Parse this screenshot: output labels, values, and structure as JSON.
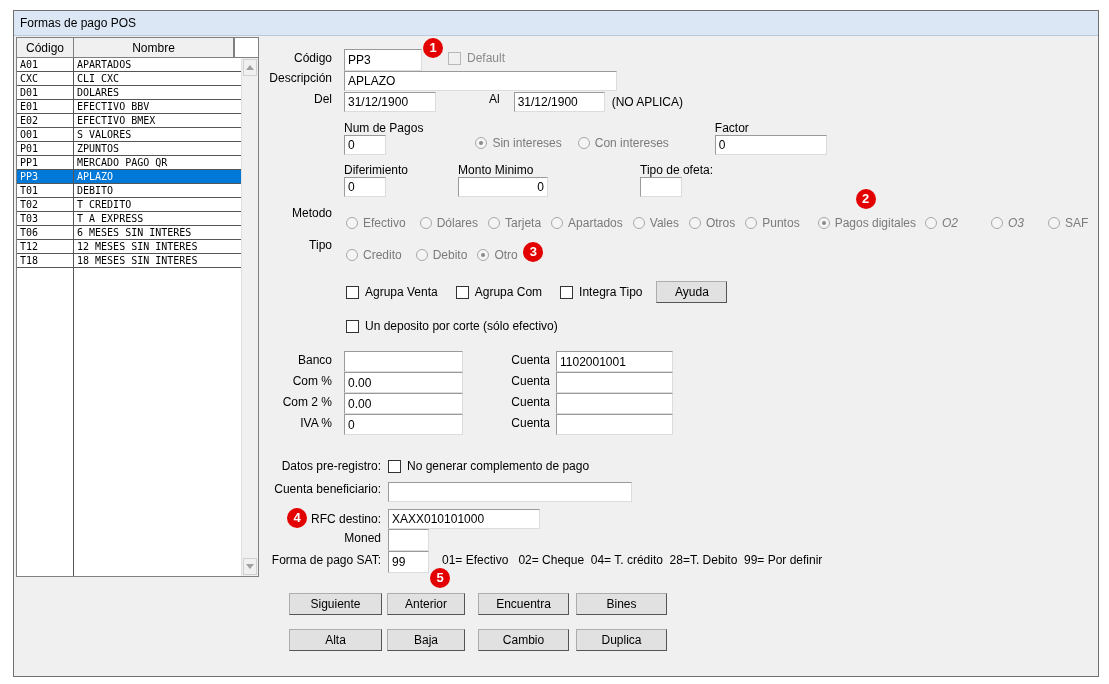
{
  "window": {
    "title": "Formas de pago POS"
  },
  "list": {
    "columns": [
      "Código",
      "Nombre"
    ],
    "rows": [
      {
        "code": "A01",
        "name": "APARTADOS",
        "selected": false
      },
      {
        "code": "CXC",
        "name": "CLI CXC",
        "selected": false
      },
      {
        "code": "D01",
        "name": "DOLARES",
        "selected": false
      },
      {
        "code": "E01",
        "name": "EFECTIVO BBV",
        "selected": false
      },
      {
        "code": "E02",
        "name": "EFECTIVO BMEX",
        "selected": false
      },
      {
        "code": "O01",
        "name": "S VALORES",
        "selected": false
      },
      {
        "code": "P01",
        "name": "ZPUNTOS",
        "selected": false
      },
      {
        "code": "PP1",
        "name": "MERCADO PAGO QR",
        "selected": false
      },
      {
        "code": "PP3",
        "name": "APLAZO",
        "selected": true
      },
      {
        "code": "T01",
        "name": "DEBITO",
        "selected": false
      },
      {
        "code": "T02",
        "name": "T CREDITO",
        "selected": false
      },
      {
        "code": "T03",
        "name": "T A EXPRESS",
        "selected": false
      },
      {
        "code": "T06",
        "name": "6 MESES SIN INTERES",
        "selected": false
      },
      {
        "code": "T12",
        "name": "12 MESES SIN INTERES",
        "selected": false
      },
      {
        "code": "T18",
        "name": "18 MESES SIN INTERES",
        "selected": false
      }
    ]
  },
  "form": {
    "codigo": {
      "label": "Código",
      "value": "PP3",
      "badge": "1"
    },
    "default": {
      "label": "Default",
      "checked": false,
      "disabled": true
    },
    "descripcion": {
      "label": "Descripción",
      "value": "APLAZO"
    },
    "del": {
      "label": "Del",
      "value": "31/12/1900"
    },
    "al": {
      "label": "Al",
      "value": "31/12/1900"
    },
    "date_note": "(NO APLICA)",
    "num_pagos": {
      "label": "Num de Pagos",
      "value": "0"
    },
    "interes_options": [
      {
        "label": "Sin intereses",
        "selected": true,
        "disabled": true
      },
      {
        "label": "Con intereses",
        "selected": false,
        "disabled": true
      }
    ],
    "factor": {
      "label": "Factor",
      "value": "0"
    },
    "diferimiento": {
      "label": "Diferimiento",
      "value": "0"
    },
    "monto_minimo": {
      "label": "Monto Minimo",
      "value": "0"
    },
    "tipo_oferta": {
      "label": "Tipo de ofeta:"
    },
    "metodo": {
      "label": "Metodo",
      "options": [
        {
          "label": "Efectivo",
          "selected": false,
          "disabled": true,
          "italic": false
        },
        {
          "label": "Dólares",
          "selected": false,
          "disabled": true,
          "italic": false
        },
        {
          "label": "Tarjeta",
          "selected": false,
          "disabled": true,
          "italic": false
        },
        {
          "label": "Apartados",
          "selected": false,
          "disabled": true,
          "italic": false
        },
        {
          "label": "Vales",
          "selected": false,
          "disabled": true,
          "italic": false
        },
        {
          "label": "Otros",
          "selected": false,
          "disabled": true,
          "italic": false
        },
        {
          "label": "Puntos",
          "selected": false,
          "disabled": true,
          "italic": false
        },
        {
          "label": "Pagos digitales",
          "selected": true,
          "disabled": true,
          "italic": false,
          "badge": "2"
        },
        {
          "label": "O2",
          "selected": false,
          "disabled": true,
          "italic": true
        },
        {
          "label": "O3",
          "selected": false,
          "disabled": true,
          "italic": true
        },
        {
          "label": "SAF",
          "selected": false,
          "disabled": true,
          "italic": false
        }
      ]
    },
    "tipo": {
      "label": "Tipo",
      "options": [
        {
          "label": "Credito",
          "selected": false,
          "disabled": true
        },
        {
          "label": "Debito",
          "selected": false,
          "disabled": true
        },
        {
          "label": "Otro",
          "selected": true,
          "disabled": true,
          "badge": "3"
        }
      ]
    },
    "checkboxes": [
      {
        "label": "Agrupa Venta",
        "checked": false
      },
      {
        "label": "Agrupa Com",
        "checked": false
      },
      {
        "label": "Integra Tipo",
        "checked": false
      }
    ],
    "help_button": "Ayuda",
    "deposit_checkbox": {
      "label": "Un deposito por corte (sólo efectivo)",
      "checked": false
    },
    "accounts": [
      {
        "label": "Banco",
        "account_label": "Cuenta",
        "account": "1102001001"
      },
      {
        "label": "Com %",
        "value": "0.00",
        "account_label": "Cuenta"
      },
      {
        "label": "Com 2 %",
        "value": "0.00",
        "account_label": "Cuenta"
      },
      {
        "label": "IVA %",
        "value": "0",
        "account_label": "Cuenta"
      }
    ],
    "pre_registro": {
      "label": "Datos pre-registro:",
      "checkbox": {
        "label": "No generar complemento de pago",
        "checked": false
      }
    },
    "cuenta_beneficiario": {
      "label": "Cuenta beneficiario:"
    },
    "rfc_destino": {
      "label": "RFC destino:",
      "value": "XAXX010101000",
      "badge": "4"
    },
    "moned": {
      "label": "Moned"
    },
    "forma_pago_sat": {
      "label": "Forma de pago SAT:",
      "value": "99",
      "badge": "5"
    },
    "sat_legend": "01= Efectivo   02= Cheque  04= T. crédito  28=T. Debito  99= Por definir",
    "button_rows": [
      [
        "Siguiente",
        "Anterior",
        "Encuentra",
        "Bines"
      ],
      [
        "Alta",
        "Baja",
        "Cambio",
        "Duplica"
      ]
    ]
  }
}
